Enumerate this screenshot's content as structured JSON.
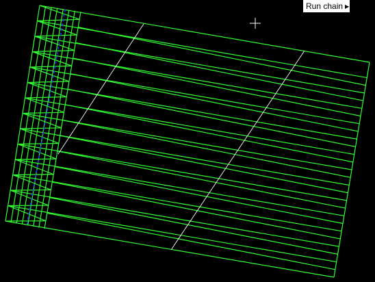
{
  "context_menu": {
    "items": [
      {
        "label": "Run chain",
        "has_submenu": true
      }
    ]
  },
  "viewport": {
    "background": "#000000",
    "wire_color": "#33ff33",
    "guide_color": "#ffffff",
    "chain_color": "#2233ff",
    "cursor": "crosshair"
  }
}
